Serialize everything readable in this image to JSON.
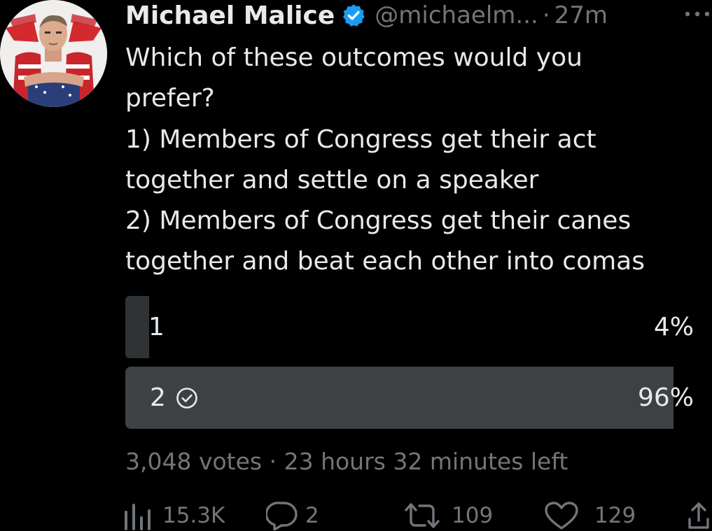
{
  "tweet": {
    "author_name": "Michael Malice",
    "handle": "@michaelm...",
    "separator": "·",
    "time": "27m",
    "text_lines": [
      "Which of these outcomes would you",
      "prefer?",
      "1) Members of Congress get their act",
      "together and settle on a speaker",
      "2) Members of Congress get their canes",
      "together and beat each other into comas"
    ]
  },
  "poll": {
    "options": [
      {
        "label": "1",
        "percent_text": "4%",
        "share": 0.04,
        "selected": false
      },
      {
        "label": "2",
        "percent_text": "96%",
        "share": 0.96,
        "selected": true
      }
    ],
    "meta": "3,048 votes · 23 hours 32 minutes left"
  },
  "actions": {
    "views": "15.3K",
    "replies": "2",
    "retweets": "109",
    "likes": "129"
  },
  "icons": {
    "verified": "verified-badge-icon",
    "more": "more-dots-icon",
    "selected_option": "check-circle-icon",
    "views": "views-bar-chart-icon",
    "reply": "reply-bubble-icon",
    "retweet": "retweet-icon",
    "like": "heart-icon",
    "share": "share-icon"
  },
  "colors": {
    "background": "#000000",
    "text": "#e7e9ea",
    "muted": "#71767b",
    "verified": "#1d9bf0",
    "poll_bar": "#2f3336",
    "poll_bar_winner": "#3e4144"
  }
}
